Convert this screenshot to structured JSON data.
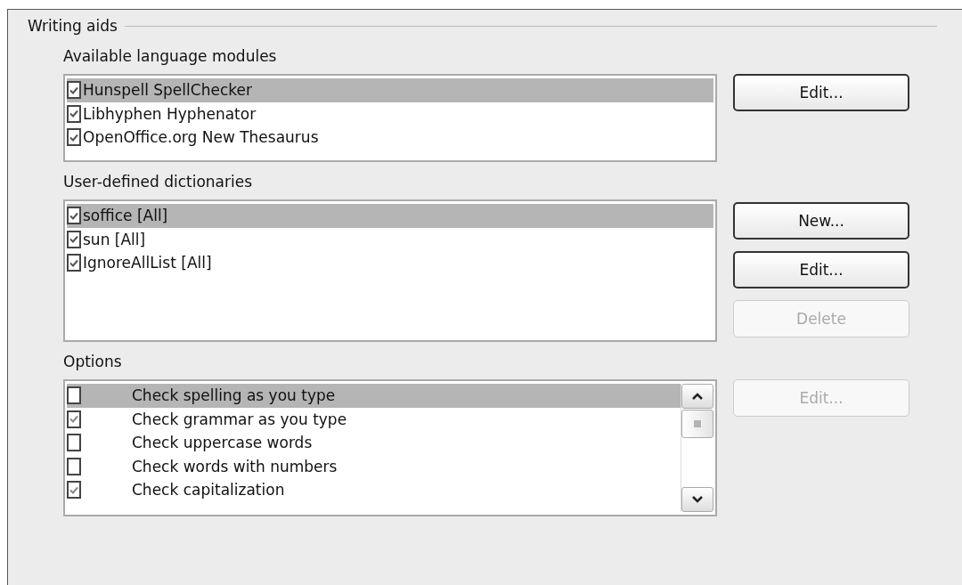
{
  "section": {
    "title": "Writing aids"
  },
  "modules": {
    "label": "Available language modules",
    "items": [
      {
        "label": "Hunspell SpellChecker",
        "checked": true,
        "selected": true
      },
      {
        "label": "Libhyphen Hyphenator",
        "checked": true,
        "selected": false
      },
      {
        "label": "OpenOffice.org New Thesaurus",
        "checked": true,
        "selected": false
      }
    ],
    "buttons": [
      {
        "label": "Edit...",
        "disabled": false
      }
    ]
  },
  "dictionaries": {
    "label": "User-defined dictionaries",
    "items": [
      {
        "label": "soffice [All]",
        "checked": true,
        "selected": true
      },
      {
        "label": "sun [All]",
        "checked": true,
        "selected": false
      },
      {
        "label": "IgnoreAllList [All]",
        "checked": true,
        "selected": false
      }
    ],
    "buttons": [
      {
        "label": "New...",
        "disabled": false
      },
      {
        "label": "Edit...",
        "disabled": false
      },
      {
        "label": "Delete",
        "disabled": true
      }
    ]
  },
  "options": {
    "label": "Options",
    "items": [
      {
        "label": "Check spelling as you type",
        "checked": false,
        "selected": true
      },
      {
        "label": "Check grammar as you type",
        "checked": true,
        "selected": false
      },
      {
        "label": "Check uppercase words",
        "checked": false,
        "selected": false
      },
      {
        "label": "Check words with numbers",
        "checked": false,
        "selected": false
      },
      {
        "label": "Check capitalization",
        "checked": true,
        "selected": false
      }
    ],
    "buttons": [
      {
        "label": "Edit...",
        "disabled": true
      }
    ]
  }
}
